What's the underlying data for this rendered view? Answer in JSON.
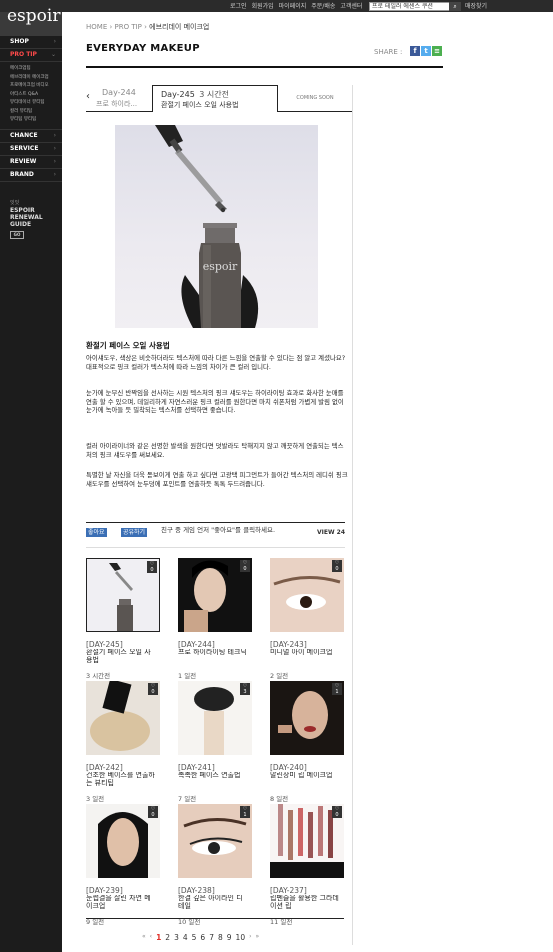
{
  "brand": {
    "logo": "espoir"
  },
  "top_nav": {
    "links": [
      "로그인",
      "회원가입",
      "마이페이지",
      "주문/배송",
      "고객센터"
    ],
    "search_placeholder": "프로 테일러 에센스 쿠션",
    "cart": "매장찾기"
  },
  "sidebar": {
    "main": [
      {
        "label": "SHOP"
      },
      {
        "label": "PRO TIP"
      },
      {
        "label": "CHANCE"
      },
      {
        "label": "SERVICE"
      },
      {
        "label": "REVIEW"
      },
      {
        "label": "BRAND"
      }
    ],
    "pro_tip_sub": [
      "메이크업팁",
      "에브리데이 메이크업",
      "프로메이크업 비디오",
      "아티스트 Q&A",
      "뷰티테이너 뷰티팁",
      "컬러 뷰티팁",
      "뷰티팁 뷰티팁"
    ],
    "renewal": {
      "small": "잇잇",
      "line1": "ESPOIR",
      "line2": "RENEWAL",
      "line3": "GUIDE",
      "btn": "GO"
    }
  },
  "breadcrumb": {
    "home": "HOME",
    "sep1": " › ",
    "pro": "PRO TIP",
    "sep2": " › ",
    "current": "에브리데이 메이크업"
  },
  "page_title": "EVERYDAY MAKEUP",
  "share_label": "SHARE :",
  "tabs": {
    "prev": {
      "day": "Day-244",
      "title": "프로 하이라..."
    },
    "current": {
      "day": "Day-245",
      "time": "3 시간전",
      "title": "환절기 페이스 오일 사용법"
    },
    "next": {
      "label": "COMING SOON"
    }
  },
  "article": {
    "title": "환절기 페이스 오일 사용법",
    "paragraphs": [
      "아이섀도우, 색상은 비슷하더라도 텍스처에 따라 다른 느낌을 연출할 수 있다는 점 알고 계셨나요? 대표적으로 핑크 컬러가 텍스처에 따라 느낌의 차이가 큰 컬러 입니다.",
      "눈가에 눈부신 반짝임을 선사하는 시원 텍스처의 핑크 섀도우는 하이라이팅 효과로 화사한 눈매를 연출 할 수 있으며, 데일리하게 자연스러운 핑크 컬러를 원한다면 마치 쉬폰처럼 가볍게 발림 없이 눈가에 녹아들 듯 밀착되는 텍스처를 선택하면 좋습니다.",
      "컬러 아이라이너와 같은 선명한 발색을 원한다면 덧발라도 탁해지지 않고 깨끗하게 연출되는 텍스처의 핑크 섀도우를 써보세요.",
      "특별한 날 자신을 더욱 돋보이게 연출 하고 싶다면 고광택 피그먼트가 들어간 텍스처의 레디쉬 핑크 섀도우를 선택하여 눈두덩에 포인트를 연출하듯 톡톡 두드려줍니다."
    ]
  },
  "like_row": {
    "btn1": "좋아요",
    "btn2": "공유하기",
    "text": "친구 중 게임 언저 \"좋아요\"를 클릭하세요.",
    "view": "VIEW 24"
  },
  "grid": [
    {
      "day": "[DAY-245]",
      "title": "환절기 페이스 오일 사용법",
      "time": "3 시간전",
      "likes": "0"
    },
    {
      "day": "[DAY-244]",
      "title": "프로 하이라이팅 테크닉",
      "time": "1 일전",
      "likes": "0"
    },
    {
      "day": "[DAY-243]",
      "title": "미니멀 아이 메이크업",
      "time": "2 일전",
      "likes": "0"
    },
    {
      "day": "[DAY-242]",
      "title": "건조한 베이스를 연출하는 뷰티팁",
      "time": "3 일전",
      "likes": "0"
    },
    {
      "day": "[DAY-241]",
      "title": "촉촉한 페이스 연출법",
      "time": "7 일전",
      "likes": "3"
    },
    {
      "day": "[DAY-240]",
      "title": "말린장미 립 메이크업",
      "time": "8 일전",
      "likes": "1"
    },
    {
      "day": "[DAY-239]",
      "title": "눈썹결을 살린 자연 메이크업",
      "time": "9 일전",
      "likes": "0"
    },
    {
      "day": "[DAY-238]",
      "title": "한결 깊은 아이라인 디테일",
      "time": "10 일전",
      "likes": "1"
    },
    {
      "day": "[DAY-237]",
      "title": "립펜슬을 활용한 그라데이션 립",
      "time": "11 일전",
      "likes": "0"
    }
  ],
  "pager": {
    "first": "«",
    "prev": "‹",
    "pages": [
      "1",
      "2",
      "3",
      "4",
      "5",
      "6",
      "7",
      "8",
      "9",
      "10"
    ],
    "next": "›",
    "last": "»"
  },
  "colors": {
    "accent_red": "#e0322b",
    "share_fb": "#3b5998",
    "share_tw": "#55acee",
    "share_gp": "#4caf50"
  }
}
